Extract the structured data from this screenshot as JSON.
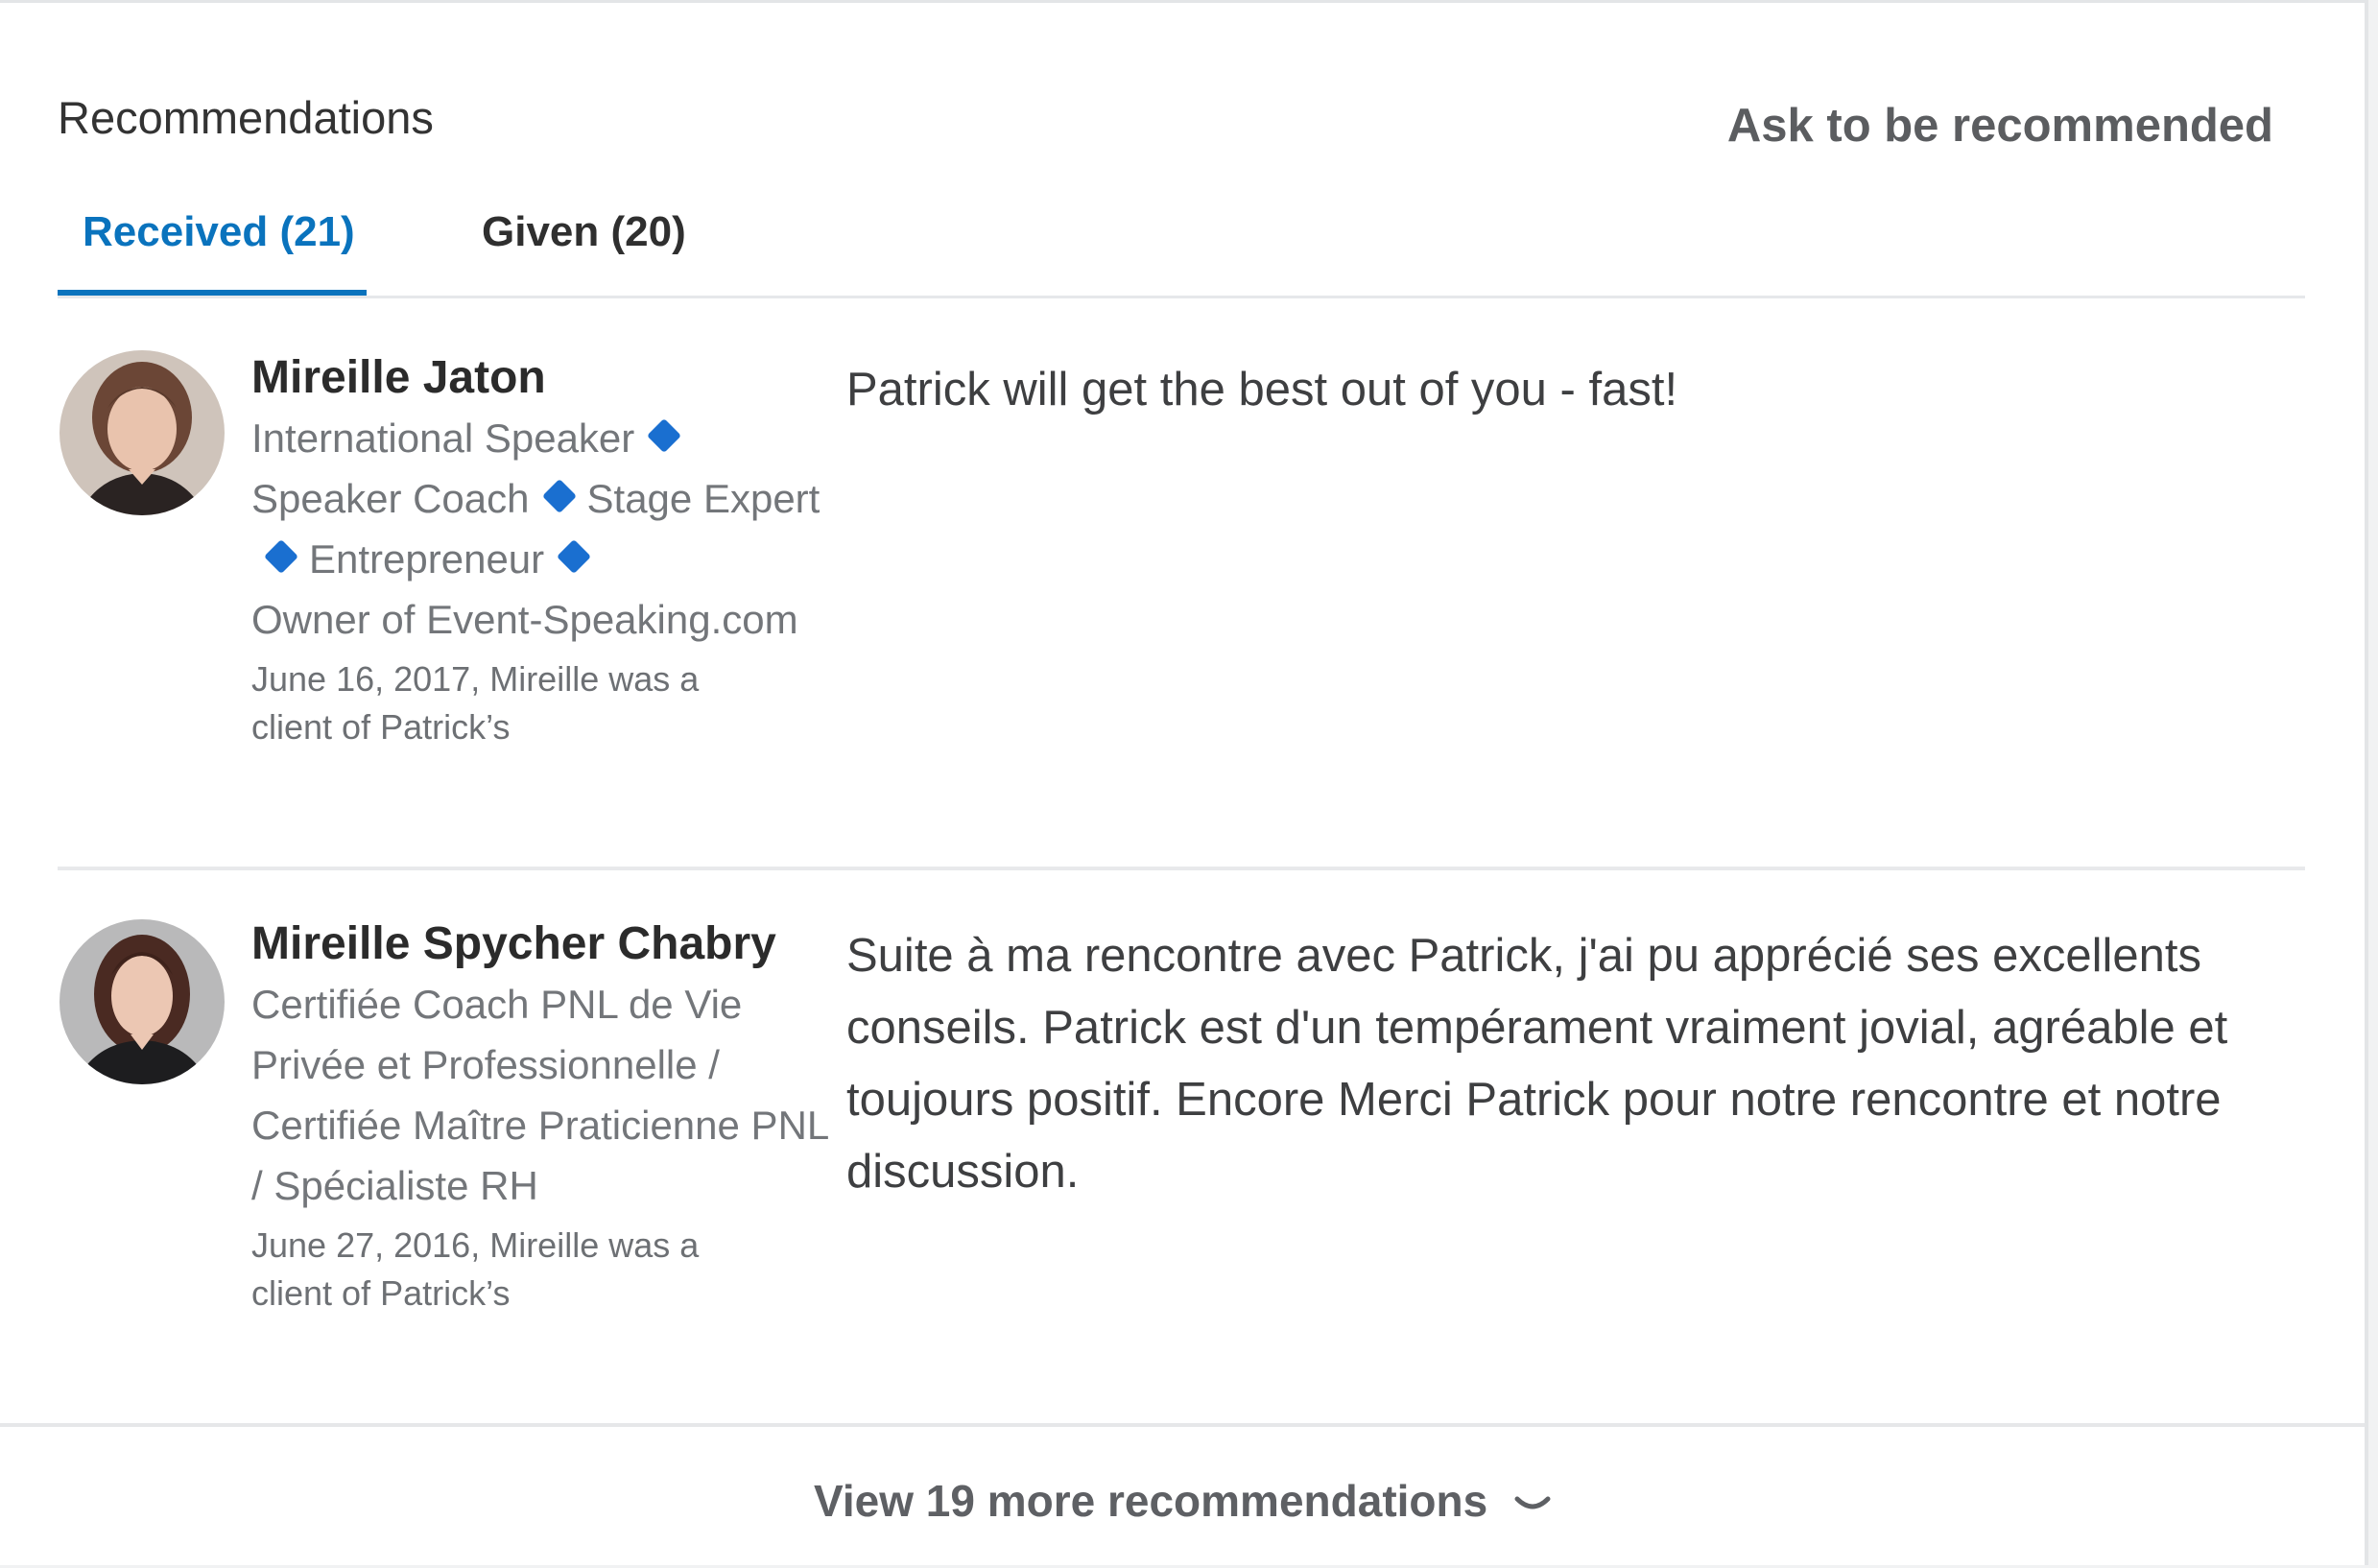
{
  "section": {
    "title": "Recommendations",
    "ask_link": "Ask to be recommended"
  },
  "tabs": [
    {
      "label": "Received (21)",
      "active": true
    },
    {
      "label": "Given (20)",
      "active": false
    }
  ],
  "recommendations": [
    {
      "name": "Mireille Jaton",
      "headline_parts": [
        "International Speaker",
        "Speaker Coach",
        "Stage Expert",
        "Entrepreneur",
        "Owner of Event-Speaking.com"
      ],
      "meta_line1": "June 16, 2017, Mireille was a",
      "meta_line2": "client of Patrick’s",
      "text": "Patrick will get the best out of you - fast!"
    },
    {
      "name": "Mireille Spycher Chabry",
      "headline": "Certifiée Coach PNL de Vie Privée et Professionnelle / Certifiée Maître Praticienne PNL / Spécialiste RH",
      "meta_line1": "June 27, 2016, Mireille was a",
      "meta_line2": "client of Patrick’s",
      "text": "Suite à ma rencontre avec Patrick, j'ai pu apprécié ses excellents conseils. Patrick est d'un tempérament vraiment jovial, agréable et toujours positif. Encore Merci Patrick pour notre rencontre et notre discussion."
    }
  ],
  "footer": {
    "more_label": "View 19 more recommendations"
  },
  "colors": {
    "accent": "#0a73bd",
    "diamond": "#1a6fd0",
    "divider": "#e6e8ea"
  },
  "icons": {
    "diamond": "blue-diamond-icon",
    "chevron": "chevron-down-icon"
  }
}
